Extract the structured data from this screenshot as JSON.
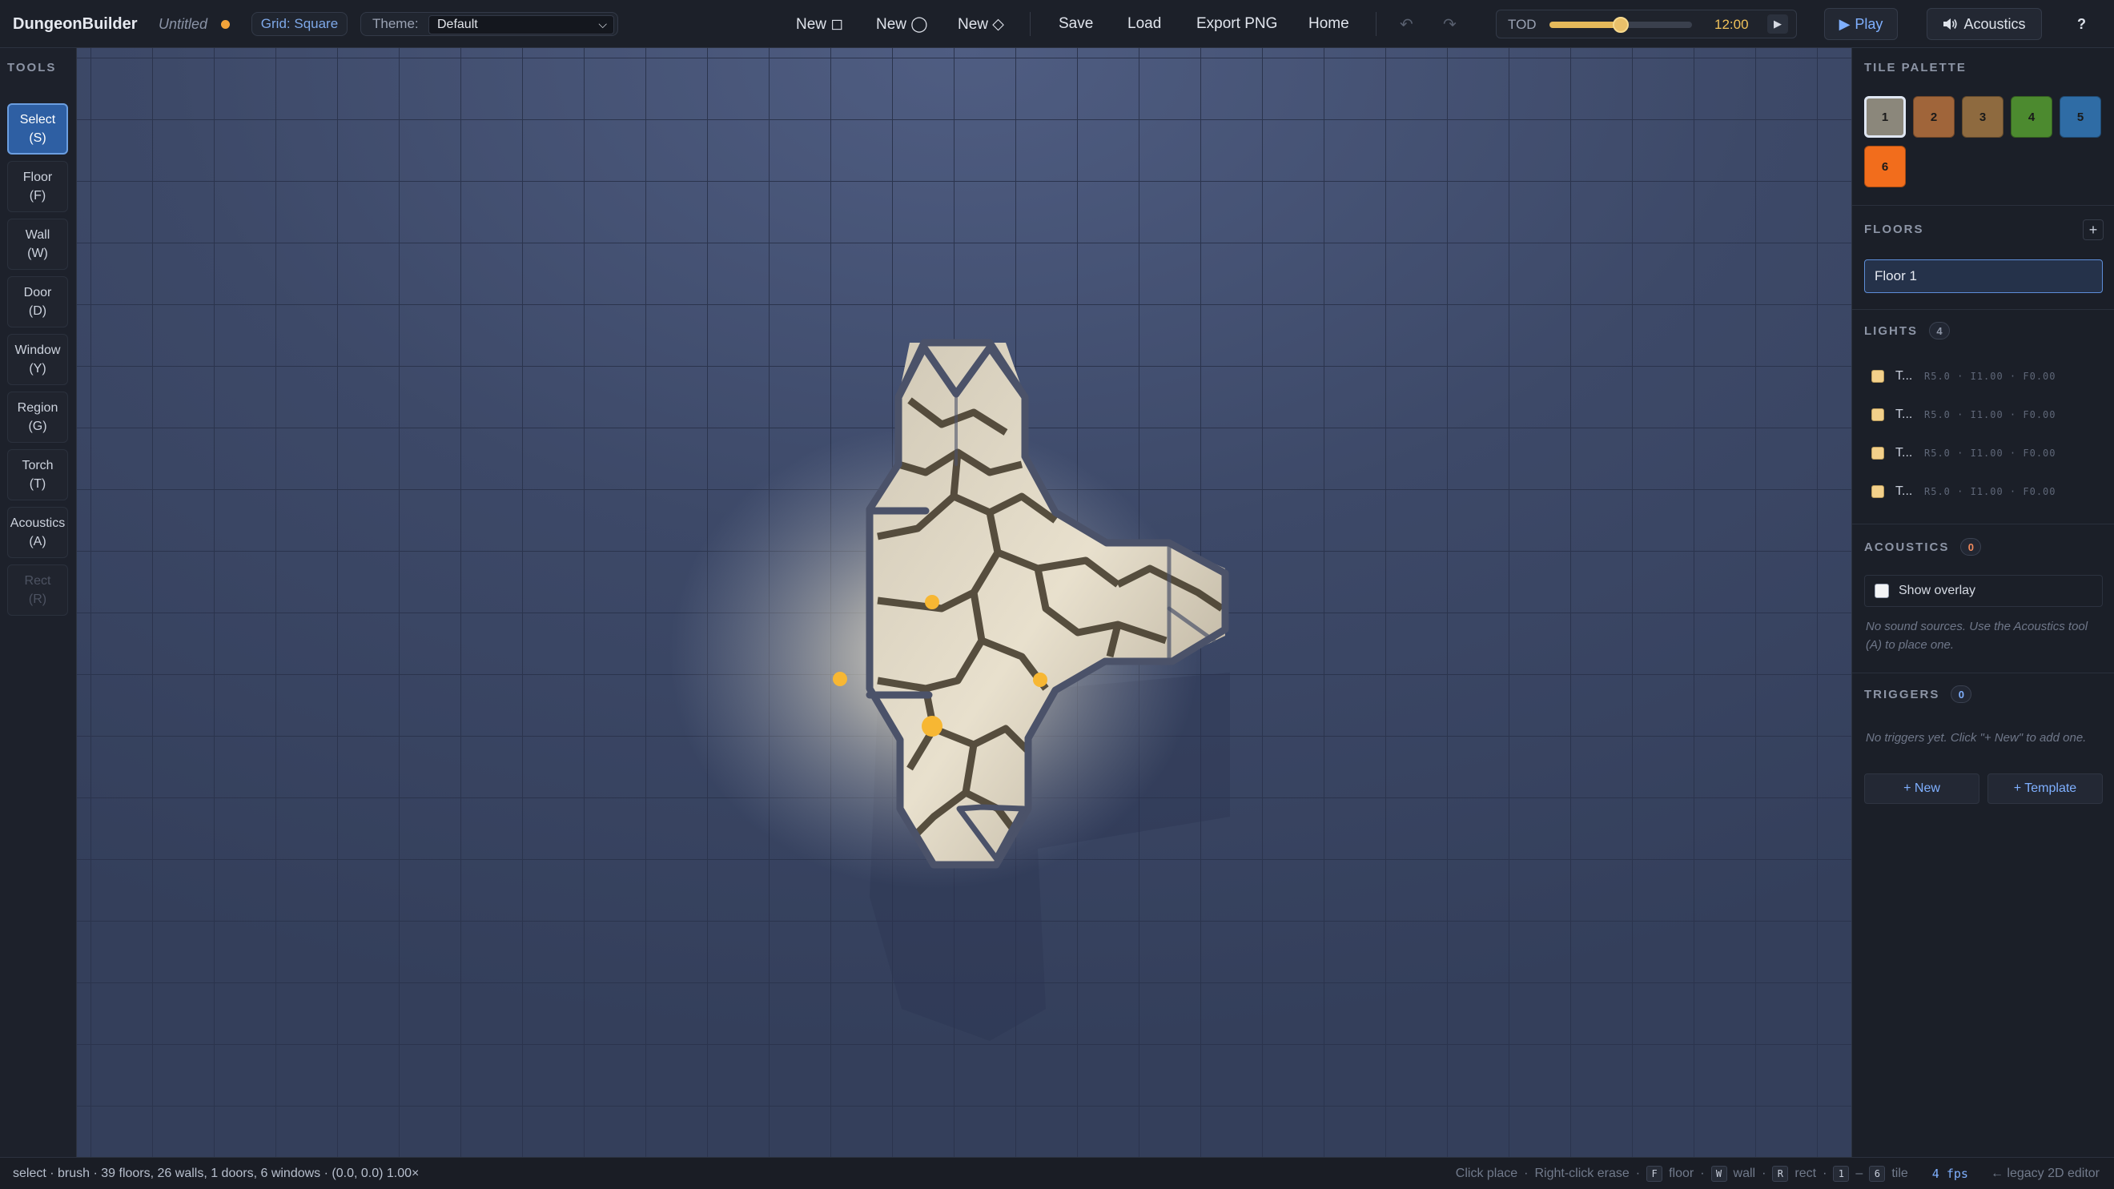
{
  "header": {
    "app_name": "DungeonBuilder",
    "doc_title": "Untitled",
    "grid_label": "Grid: Square",
    "theme_label": "Theme:",
    "theme_value": "Default",
    "new_square": "New ◻",
    "new_circle": "New ◯",
    "new_diamond": "New ◇",
    "save": "Save",
    "load": "Load",
    "export_png": "Export PNG",
    "home": "Home",
    "undo_glyph": "↶",
    "redo_glyph": "↷",
    "tod_label": "TOD",
    "tod_value": "12:00",
    "tod_level": 0.5,
    "play_label": "Play",
    "acoustics_label": "Acoustics",
    "help": "?"
  },
  "tools": {
    "title": "TOOLS",
    "items": [
      {
        "label": "Select\n(S)",
        "state": "active"
      },
      {
        "label": "Floor\n(F)",
        "state": "normal"
      },
      {
        "label": "Wall\n(W)",
        "state": "normal"
      },
      {
        "label": "Door\n(D)",
        "state": "normal"
      },
      {
        "label": "Window\n(Y)",
        "state": "normal"
      },
      {
        "label": "Region\n(G)",
        "state": "normal"
      },
      {
        "label": "Torch\n(T)",
        "state": "normal"
      },
      {
        "label": "Acoustics\n(A)",
        "state": "normal"
      },
      {
        "label": "Rect\n(R)",
        "state": "disabled"
      }
    ]
  },
  "palette": {
    "title": "TILE PALETTE",
    "tiles": [
      {
        "label": "1",
        "color": "#8b877b",
        "selected": true
      },
      {
        "label": "2",
        "color": "#a0653a",
        "selected": false
      },
      {
        "label": "3",
        "color": "#8e6a3f",
        "selected": false
      },
      {
        "label": "4",
        "color": "#4c8a2f",
        "selected": false
      },
      {
        "label": "5",
        "color": "#2f6ca5",
        "selected": false
      },
      {
        "label": "6",
        "color": "#f26d1c",
        "selected": false
      }
    ]
  },
  "floors": {
    "title": "FLOORS",
    "add": "+",
    "items": [
      "Floor 1"
    ]
  },
  "lights": {
    "title": "LIGHTS",
    "count": "4",
    "items": [
      {
        "name": "T...",
        "meta": "R5.0 · I1.00 · F0.00"
      },
      {
        "name": "T...",
        "meta": "R5.0 · I1.00 · F0.00"
      },
      {
        "name": "T...",
        "meta": "R5.0 · I1.00 · F0.00"
      },
      {
        "name": "T...",
        "meta": "R5.0 · I1.00 · F0.00"
      }
    ]
  },
  "acoustics": {
    "title": "ACOUSTICS",
    "count": "0",
    "overlay_label": "Show overlay",
    "hint": "No sound sources. Use the Acoustics tool (A) to place one."
  },
  "triggers": {
    "title": "TRIGGERS",
    "count": "0",
    "hint": "No triggers yet. Click \"+ New\" to add one.",
    "new_label": "+ New",
    "template_label": "+ Template"
  },
  "status": {
    "left": "select · brush · 39 floors, 26 walls, 1 doors, 6 windows · (0.0, 0.0) 1.00×",
    "click_place": "Click place",
    "dot": "·",
    "right_click": "Right-click erase",
    "key_f": "F",
    "floor_word": "floor",
    "key_w": "W",
    "wall_word": "wall",
    "key_r": "R",
    "rect_word": "rect",
    "key_1": "1",
    "dash": "–",
    "key_6": "6",
    "tile_word": "tile",
    "fps": "4 fps",
    "legacy": "← legacy 2D editor"
  },
  "colors": {
    "accent": "#7fb0ff",
    "canvas_bg": "#3a4665",
    "grid_line": "#2d3752",
    "wall": "#4a5068",
    "torch": "#f7b733",
    "selected_tool": "#2e5fa3"
  }
}
